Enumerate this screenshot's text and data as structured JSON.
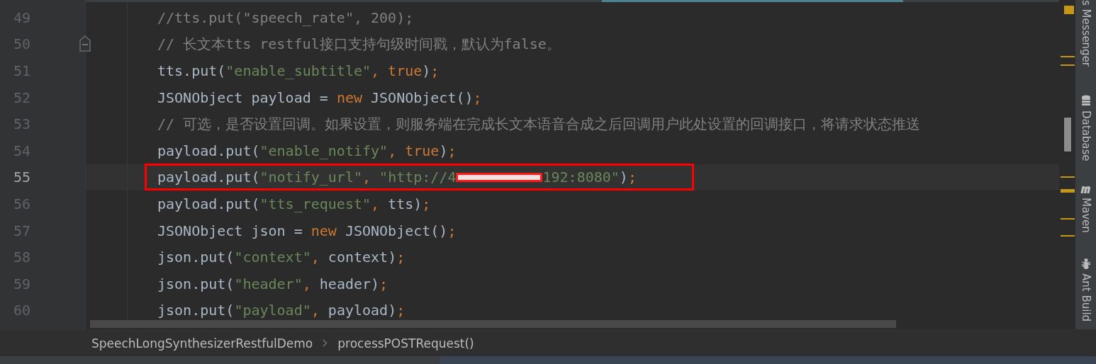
{
  "editor": {
    "lines": [
      {
        "number": "49",
        "current": false,
        "fold": false,
        "boxed": false,
        "tokens": [
          {
            "kind": "comment",
            "text": "//tts.put(\"speech_rate\", 200);"
          }
        ]
      },
      {
        "number": "50",
        "current": false,
        "fold": true,
        "boxed": false,
        "tokens": [
          {
            "kind": "comment",
            "text": "// 长文本tts restful接口支持句级时间戳，默认为false。"
          }
        ]
      },
      {
        "number": "51",
        "current": false,
        "fold": false,
        "boxed": false,
        "tokens": [
          {
            "kind": "plain",
            "text": "tts.put("
          },
          {
            "kind": "string",
            "text": "\"enable_subtitle\""
          },
          {
            "kind": "keyword",
            "text": ", true"
          },
          {
            "kind": "plain",
            "text": ")"
          },
          {
            "kind": "keyword",
            "text": ";"
          }
        ]
      },
      {
        "number": "52",
        "current": false,
        "fold": false,
        "boxed": false,
        "tokens": [
          {
            "kind": "plain",
            "text": "JSONObject payload = "
          },
          {
            "kind": "keyword",
            "text": "new"
          },
          {
            "kind": "plain",
            "text": " JSONObject()"
          },
          {
            "kind": "keyword",
            "text": ";"
          }
        ]
      },
      {
        "number": "53",
        "current": false,
        "fold": false,
        "boxed": false,
        "tokens": [
          {
            "kind": "comment",
            "text": "// 可选，是否设置回调。如果设置，则服务端在完成长文本语音合成之后回调用户此处设置的回调接口，将请求状态推送"
          }
        ]
      },
      {
        "number": "54",
        "current": false,
        "fold": false,
        "boxed": false,
        "tokens": [
          {
            "kind": "plain",
            "text": "payload.put("
          },
          {
            "kind": "string",
            "text": "\"enable_notify\""
          },
          {
            "kind": "keyword",
            "text": ", true"
          },
          {
            "kind": "plain",
            "text": ")"
          },
          {
            "kind": "keyword",
            "text": ";"
          }
        ]
      },
      {
        "number": "55",
        "current": true,
        "fold": false,
        "boxed": true,
        "tokens": [
          {
            "kind": "plain",
            "text": "payload.put("
          },
          {
            "kind": "string",
            "text": "\"notify_url\""
          },
          {
            "kind": "keyword",
            "text": ", "
          },
          {
            "kind": "string",
            "text": "\"http://4"
          },
          {
            "kind": "redaction"
          },
          {
            "kind": "string",
            "text": "192:8080\""
          },
          {
            "kind": "plain",
            "text": ")"
          },
          {
            "kind": "keyword",
            "text": ";"
          }
        ]
      },
      {
        "number": "56",
        "current": false,
        "fold": false,
        "boxed": false,
        "tokens": [
          {
            "kind": "plain",
            "text": "payload.put("
          },
          {
            "kind": "string",
            "text": "\"tts_request\""
          },
          {
            "kind": "keyword",
            "text": ", "
          },
          {
            "kind": "plain",
            "text": "tts)"
          },
          {
            "kind": "keyword",
            "text": ";"
          }
        ]
      },
      {
        "number": "57",
        "current": false,
        "fold": false,
        "boxed": false,
        "tokens": [
          {
            "kind": "plain",
            "text": "JSONObject json = "
          },
          {
            "kind": "keyword",
            "text": "new"
          },
          {
            "kind": "plain",
            "text": " JSONObject()"
          },
          {
            "kind": "keyword",
            "text": ";"
          }
        ]
      },
      {
        "number": "58",
        "current": false,
        "fold": false,
        "boxed": false,
        "tokens": [
          {
            "kind": "plain",
            "text": "json.put("
          },
          {
            "kind": "string",
            "text": "\"context\""
          },
          {
            "kind": "keyword",
            "text": ", "
          },
          {
            "kind": "plain",
            "text": "context)"
          },
          {
            "kind": "keyword",
            "text": ";"
          }
        ]
      },
      {
        "number": "59",
        "current": false,
        "fold": false,
        "boxed": false,
        "tokens": [
          {
            "kind": "plain",
            "text": "json.put("
          },
          {
            "kind": "string",
            "text": "\"header\""
          },
          {
            "kind": "keyword",
            "text": ", "
          },
          {
            "kind": "plain",
            "text": "header)"
          },
          {
            "kind": "keyword",
            "text": ";"
          }
        ]
      },
      {
        "number": "60",
        "current": false,
        "fold": false,
        "boxed": false,
        "tokens": [
          {
            "kind": "plain",
            "text": "json.put("
          },
          {
            "kind": "string",
            "text": "\"payload\""
          },
          {
            "kind": "keyword",
            "text": ", "
          },
          {
            "kind": "plain",
            "text": "payload)"
          },
          {
            "kind": "keyword",
            "text": ";"
          }
        ]
      }
    ]
  },
  "breadcrumbs": [
    "SpeechLongSynthesizerRestfulDemo",
    "processPOSTRequest()"
  ],
  "side_tabs": [
    {
      "kind": "messenger",
      "label": "s Messenger"
    },
    {
      "kind": "database",
      "label": "Database"
    },
    {
      "kind": "maven",
      "label": "Maven"
    },
    {
      "kind": "ant",
      "label": "Ant Build"
    }
  ]
}
